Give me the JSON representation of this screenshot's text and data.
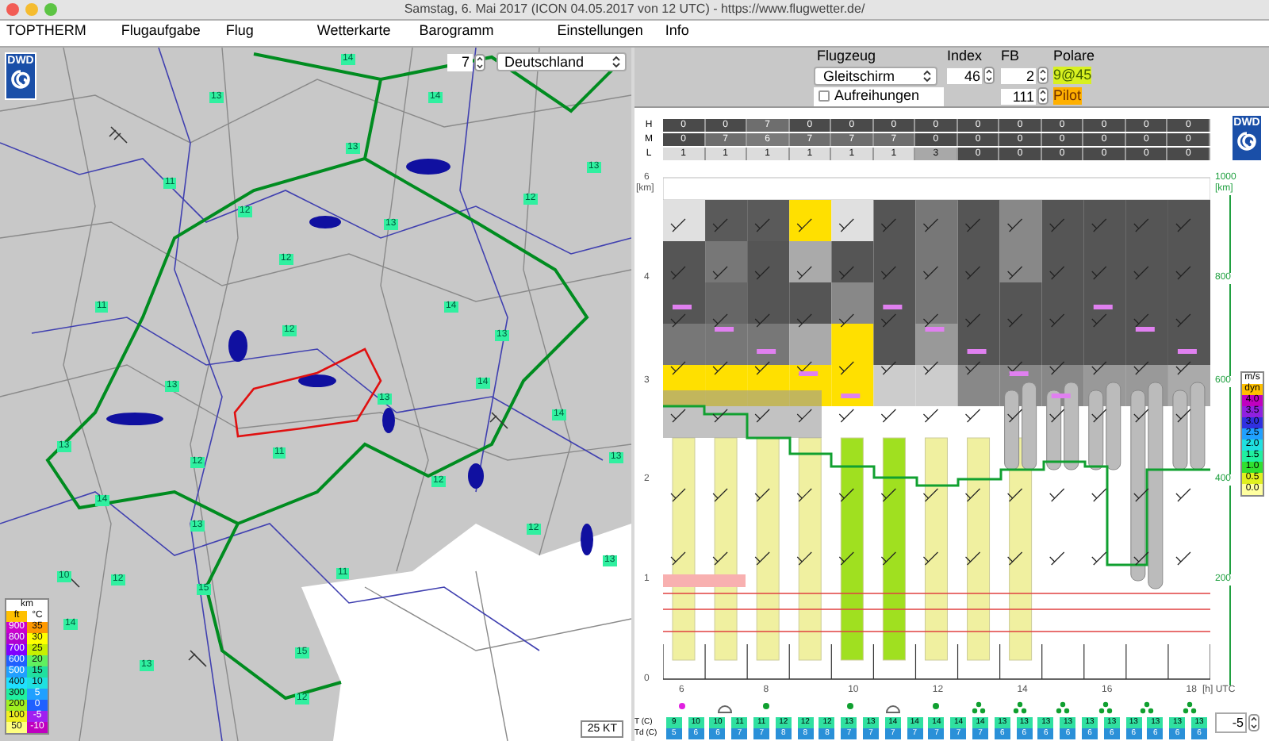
{
  "window": {
    "title": "Samstag, 6. Mai 2017 (ICON 04.05.2017 von 12 UTC) - https://www.flugwetter.de/"
  },
  "menu": [
    "TOPTHERM",
    "Flugaufgabe",
    "Flug",
    "Wetterkarte",
    "Barogramm",
    "Einstellungen",
    "Info"
  ],
  "map": {
    "logo": "DWD",
    "zoom_value": "7",
    "region": "Deutschland",
    "scale": "25 KT",
    "badges": [
      "13",
      "14",
      "14",
      "13",
      "11",
      "12",
      "12",
      "13",
      "12",
      "13",
      "14",
      "13",
      "11",
      "13",
      "12",
      "13",
      "14",
      "14",
      "13",
      "12",
      "13",
      "11",
      "12",
      "13",
      "12",
      "14",
      "13",
      "10",
      "11",
      "15",
      "15",
      "12",
      "14",
      "13",
      "12"
    ],
    "legend": {
      "altitude_header": "km",
      "altitude_unit": "ft",
      "temperature_unit": "°C",
      "rows": [
        {
          "altitude": {
            "value": "900",
            "color": "#cc00cc"
          },
          "temperature": {
            "value": "35",
            "color": "#ff9900"
          }
        },
        {
          "altitude": {
            "value": "800",
            "color": "#b000d0"
          },
          "temperature": {
            "value": "30",
            "color": "#ffff00"
          }
        },
        {
          "altitude": {
            "value": "700",
            "color": "#8000ff"
          },
          "temperature": {
            "value": "25",
            "color": "#c8f000"
          }
        },
        {
          "altitude": {
            "value": "600",
            "color": "#2060ff"
          },
          "temperature": {
            "value": "20",
            "color": "#60f060"
          }
        },
        {
          "altitude": {
            "value": "500",
            "color": "#20a0ff"
          },
          "temperature": {
            "value": "15",
            "color": "#20e0a0"
          }
        },
        {
          "altitude": {
            "value": "400",
            "color": "#20e0ff"
          },
          "temperature": {
            "value": "10",
            "color": "#20e0e0"
          }
        },
        {
          "altitude": {
            "value": "300",
            "color": "#20f0a0"
          },
          "temperature": {
            "value": "5",
            "color": "#20a0ff"
          }
        },
        {
          "altitude": {
            "value": "200",
            "color": "#a0f020"
          },
          "temperature": {
            "value": "0",
            "color": "#2060ff"
          }
        },
        {
          "altitude": {
            "value": "100",
            "color": "#f0f020"
          },
          "temperature": {
            "value": "-5",
            "color": "#a020f0"
          }
        },
        {
          "altitude": {
            "value": "50",
            "color": "#ffff80"
          },
          "temperature": {
            "value": "-10",
            "color": "#c000c0"
          }
        }
      ]
    }
  },
  "settings": {
    "aircraft_label": "Flugzeug",
    "aircraft": "Gleitschirm",
    "index_label": "Index",
    "index": "46",
    "fb_label": "FB",
    "fb": "2",
    "polar_label": "Polare",
    "polar": "9@45",
    "alignment": {
      "label": "Aufreihungen",
      "checked": false
    },
    "weight": "111",
    "pilot": "Pilot"
  },
  "cloud_rows": [
    {
      "label": "H",
      "cells": [
        {
          "value": "0",
          "color": "#4a4a4a"
        },
        {
          "value": "0",
          "color": "#4a4a4a"
        },
        {
          "value": "7",
          "color": "#6e6e6e"
        },
        {
          "value": "0",
          "color": "#4a4a4a"
        },
        {
          "value": "0",
          "color": "#4a4a4a"
        },
        {
          "value": "0",
          "color": "#4a4a4a"
        },
        {
          "value": "0",
          "color": "#4a4a4a"
        },
        {
          "value": "0",
          "color": "#4a4a4a"
        },
        {
          "value": "0",
          "color": "#4a4a4a"
        },
        {
          "value": "0",
          "color": "#4a4a4a"
        },
        {
          "value": "0",
          "color": "#4a4a4a"
        },
        {
          "value": "0",
          "color": "#4a4a4a"
        },
        {
          "value": "0",
          "color": "#4a4a4a"
        }
      ]
    },
    {
      "label": "M",
      "cells": [
        {
          "value": "0",
          "color": "#4a4a4a"
        },
        {
          "value": "7",
          "color": "#6e6e6e"
        },
        {
          "value": "6",
          "color": "#7a7a7a"
        },
        {
          "value": "7",
          "color": "#6e6e6e"
        },
        {
          "value": "7",
          "color": "#6e6e6e"
        },
        {
          "value": "7",
          "color": "#6e6e6e"
        },
        {
          "value": "0",
          "color": "#4a4a4a"
        },
        {
          "value": "0",
          "color": "#4a4a4a"
        },
        {
          "value": "0",
          "color": "#4a4a4a"
        },
        {
          "value": "0",
          "color": "#4a4a4a"
        },
        {
          "value": "0",
          "color": "#4a4a4a"
        },
        {
          "value": "0",
          "color": "#4a4a4a"
        },
        {
          "value": "0",
          "color": "#4a4a4a"
        }
      ]
    },
    {
      "label": "L",
      "cells": [
        {
          "value": "1",
          "color": "#dcdcdc"
        },
        {
          "value": "1",
          "color": "#dcdcdc"
        },
        {
          "value": "1",
          "color": "#dcdcdc"
        },
        {
          "value": "1",
          "color": "#dcdcdc"
        },
        {
          "value": "1",
          "color": "#dcdcdc"
        },
        {
          "value": "1",
          "color": "#dcdcdc"
        },
        {
          "value": "3",
          "color": "#a8a8a8"
        },
        {
          "value": "0",
          "color": "#4a4a4a"
        },
        {
          "value": "0",
          "color": "#4a4a4a"
        },
        {
          "value": "0",
          "color": "#4a4a4a"
        },
        {
          "value": "0",
          "color": "#4a4a4a"
        },
        {
          "value": "0",
          "color": "#4a4a4a"
        },
        {
          "value": "0",
          "color": "#4a4a4a"
        }
      ]
    }
  ],
  "sounding": {
    "logo": "DWD",
    "height_ticks": [
      "6",
      "4",
      "3",
      "2",
      "1",
      "0"
    ],
    "height_unit": "[km]",
    "right_ticks": [
      "1000",
      "800",
      "600",
      "400",
      "200"
    ],
    "right_unit": "[km]",
    "time_ticks": [
      "6",
      "8",
      "10",
      "12",
      "14",
      "16",
      "18"
    ],
    "time_unit": "[h] UTC",
    "climb_legend": {
      "header": "m/s",
      "items": [
        {
          "value": "dyn",
          "color": "#ffc000"
        },
        {
          "value": "4.0",
          "color": "#c000c0"
        },
        {
          "value": "3.5",
          "color": "#9020e0"
        },
        {
          "value": "3.0",
          "color": "#3030e0"
        },
        {
          "value": "2.5",
          "color": "#20a0ff"
        },
        {
          "value": "2.0",
          "color": "#20e0e0"
        },
        {
          "value": "1.5",
          "color": "#20f0a0"
        },
        {
          "value": "1.0",
          "color": "#30e030"
        },
        {
          "value": "0.5",
          "color": "#e0f020"
        },
        {
          "value": "0.0",
          "color": "#ffffa0"
        }
      ]
    }
  },
  "temperature_row": {
    "label": "T (C)",
    "values": [
      "9",
      "10",
      "10",
      "11",
      "11",
      "12",
      "12",
      "12",
      "13",
      "13",
      "14",
      "14",
      "14",
      "14",
      "14",
      "13",
      "13",
      "13",
      "13",
      "13",
      "13",
      "13",
      "13",
      "13",
      "13"
    ]
  },
  "dewpoint_row": {
    "label": "Td (C)",
    "values": [
      "5",
      "6",
      "6",
      "7",
      "7",
      "8",
      "8",
      "8",
      "7",
      "7",
      "7",
      "7",
      "7",
      "7",
      "7",
      "6",
      "6",
      "6",
      "6",
      "6",
      "6",
      "6",
      "6",
      "6",
      "6"
    ]
  },
  "offset_field": "-5"
}
